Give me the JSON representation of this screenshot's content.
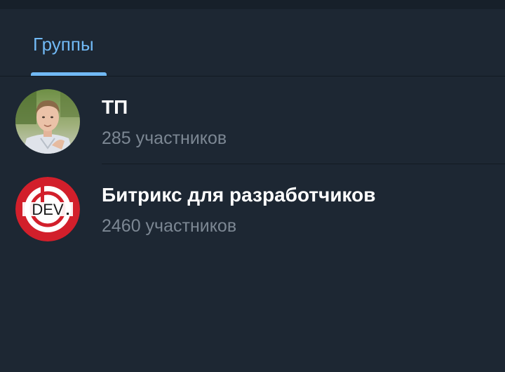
{
  "tabs": [
    {
      "label": "Группы",
      "selected": true
    }
  ],
  "groups": [
    {
      "title": "ТП",
      "subtitle": "285 участников",
      "avatar": "person-photo"
    },
    {
      "title": "Битрикс для разработчиков",
      "subtitle": "2460 участников",
      "avatar": "bitrix-dev-logo",
      "avatar_text": "DEV"
    }
  ],
  "colors": {
    "background": "#1d2733",
    "accent": "#71b9f5",
    "title": "#ffffff",
    "subtitle": "#7c8793",
    "logo_red": "#d21f2b"
  }
}
